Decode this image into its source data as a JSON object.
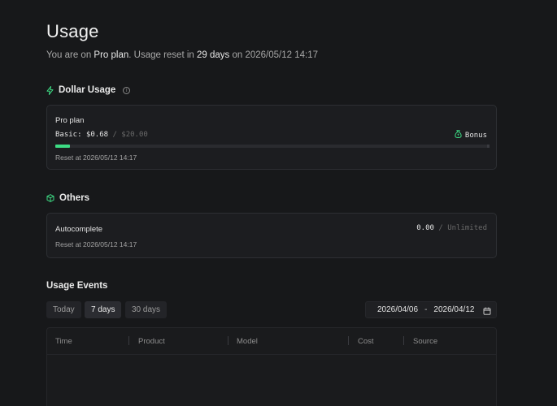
{
  "header": {
    "title": "Usage",
    "subtitle_prefix": "You are on ",
    "plan_name": "Pro plan",
    "subtitle_mid": ". Usage reset in ",
    "days_remaining": "29 days",
    "subtitle_on": " on ",
    "reset_datetime": "2026/05/12 14:17"
  },
  "dollar_usage": {
    "heading": "Dollar Usage",
    "info_icon": "i",
    "card": {
      "plan_label": "Pro plan",
      "basic_label": "Basic: ",
      "used": "$0.68",
      "separator": " / ",
      "limit": "$20.00",
      "bonus_label": "Bonus",
      "progress_fraction": 0.034,
      "reset_text": "Reset at 2026/05/12 14:17"
    }
  },
  "others": {
    "heading": "Others",
    "card": {
      "label": "Autocomplete",
      "used": "0.00",
      "separator": " / ",
      "limit": "Unlimited",
      "reset_text": "Reset at 2026/05/12 14:17"
    }
  },
  "events": {
    "heading": "Usage Events",
    "filters": [
      "Today",
      "7 days",
      "30 days"
    ],
    "active_filter": "7 days",
    "date_from": "2026/04/06",
    "date_sep": "-",
    "date_to": "2026/04/12",
    "columns": [
      "Time",
      "Product",
      "Model",
      "Cost",
      "Source"
    ]
  },
  "colors": {
    "accent": "#3ddc84",
    "background": "#17181a",
    "card": "#1c1d20"
  },
  "icons": {
    "dollar_usage": "lightning-icon",
    "others": "cube-icon",
    "bonus": "money-bag-icon",
    "date": "calendar-icon"
  }
}
